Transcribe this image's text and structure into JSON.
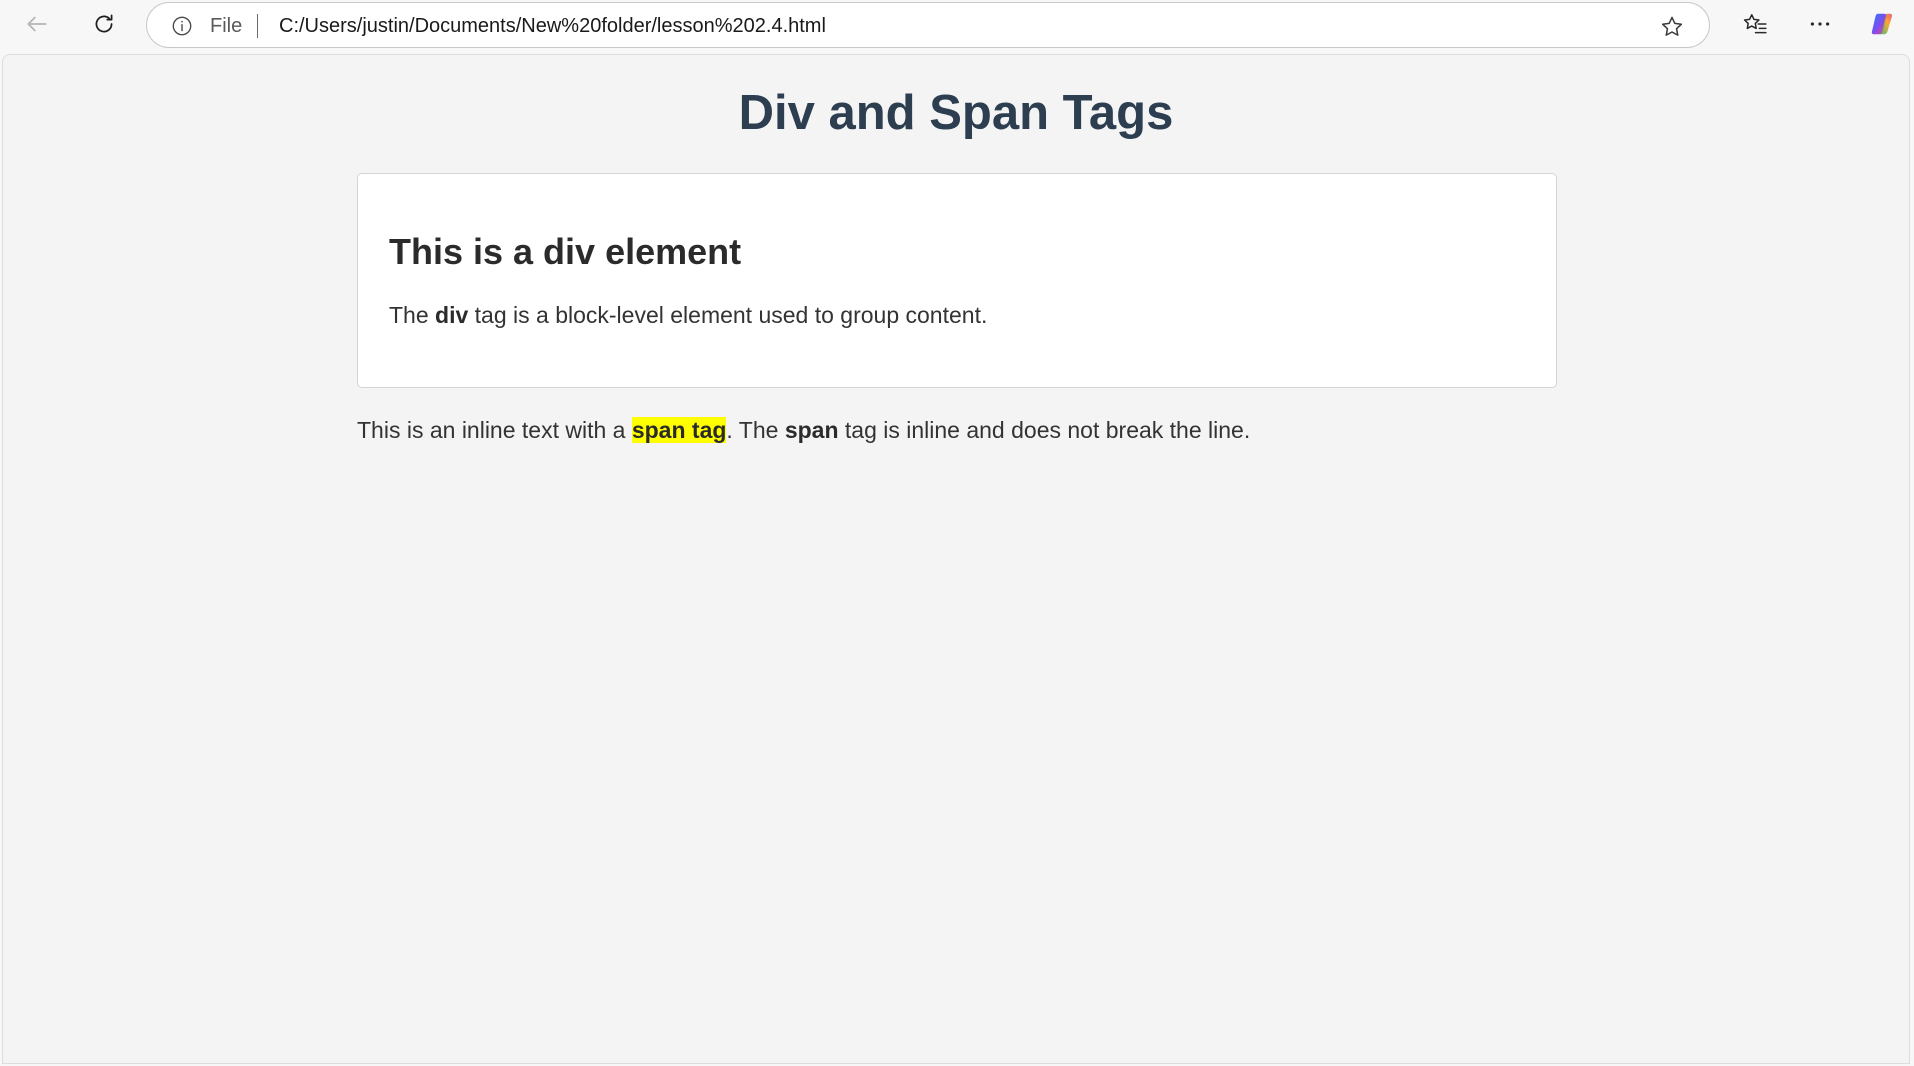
{
  "browser": {
    "address": {
      "scheme_label": "File",
      "url": "C:/Users/justin/Documents/New%20folder/lesson%202.4.html"
    },
    "icons": {
      "back": "back-arrow-icon",
      "refresh": "refresh-icon",
      "info": "info-icon",
      "favorite": "star-icon",
      "favorites_list": "favorites-icon",
      "more": "more-icon",
      "copilot": "copilot-icon"
    },
    "colors": {
      "copilot_gradient": [
        "#2f7bf6",
        "#7a4ff0",
        "#f0486e",
        "#f7a21b",
        "#28b878"
      ]
    }
  },
  "page": {
    "title": "Div and Span Tags",
    "div_box": {
      "heading": "This is a div element",
      "text_before": "The ",
      "text_bold": "div",
      "text_after": " tag is a block-level element used to group content."
    },
    "inline": {
      "text_before": "This is an inline text with a ",
      "highlight": "span tag",
      "text_middle": ". The ",
      "text_bold": "span",
      "text_after": " tag is inline and does not break the line."
    },
    "colors": {
      "title": "#2c3e50",
      "highlight": "#ffff00",
      "background": "#f4f4f4"
    }
  }
}
